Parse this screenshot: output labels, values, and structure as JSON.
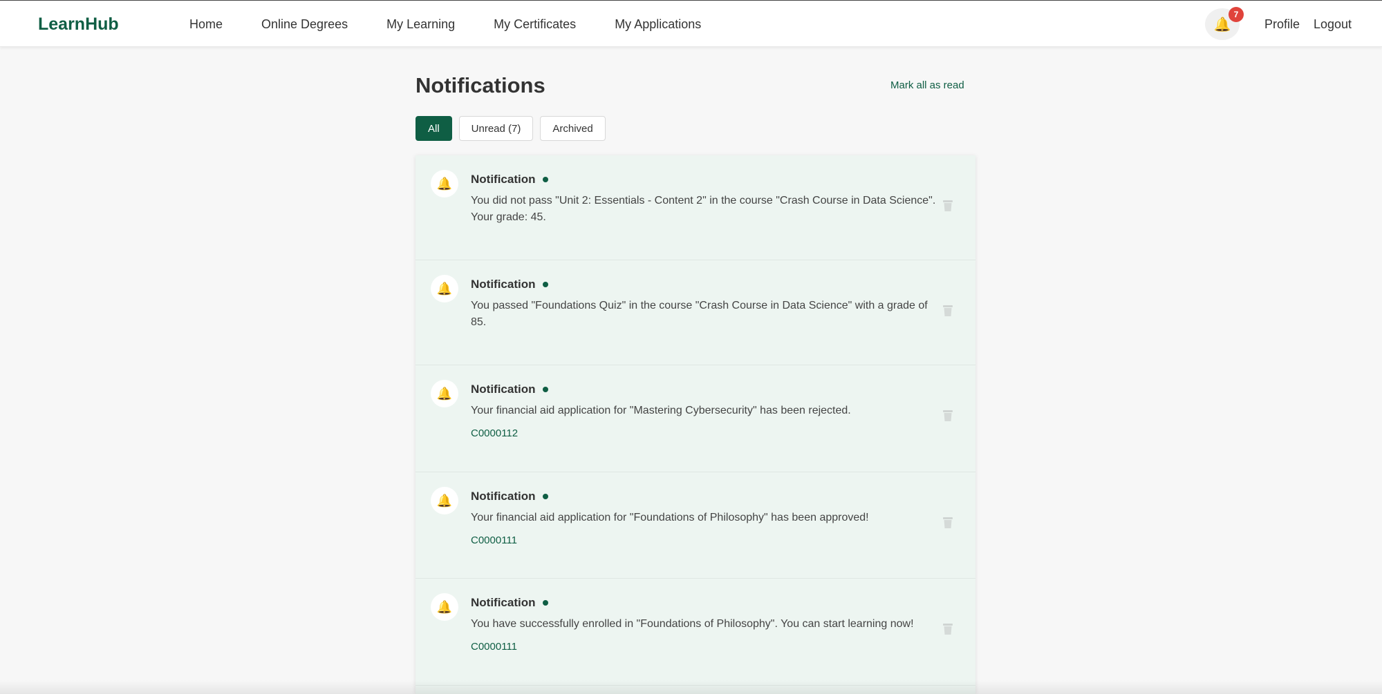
{
  "header": {
    "logo": "LearnHub",
    "nav": [
      "Home",
      "Online Degrees",
      "My Learning",
      "My Certificates",
      "My Applications"
    ],
    "notification_count": "7",
    "profile": "Profile",
    "logout": "Logout"
  },
  "page": {
    "title": "Notifications",
    "mark_all": "Mark all as read",
    "filters": [
      {
        "label": "All",
        "active": true
      },
      {
        "label": "Unread (7)",
        "active": false
      },
      {
        "label": "Archived",
        "active": false
      }
    ]
  },
  "notifications": [
    {
      "title": "Notification",
      "message": "You did not pass \"Unit 2: Essentials - Content 2\" in the course \"Crash Course in Data Science\". Your grade: 45.",
      "code": ""
    },
    {
      "title": "Notification",
      "message": "You passed \"Foundations Quiz\" in the course \"Crash Course in Data Science\" with a grade of 85.",
      "code": ""
    },
    {
      "title": "Notification",
      "message": "Your financial aid application for \"Mastering Cybersecurity\" has been rejected.",
      "code": "C0000112"
    },
    {
      "title": "Notification",
      "message": "Your financial aid application for \"Foundations of Philosophy\" has been approved!",
      "code": "C0000111"
    },
    {
      "title": "Notification",
      "message": "You have successfully enrolled in \"Foundations of Philosophy\". You can start learning now!",
      "code": "C0000111"
    }
  ],
  "colors": {
    "brand": "#0f5e44",
    "badge": "#e0433b",
    "card_bg": "#edf5f1"
  },
  "icons": {
    "bell": "bell-icon",
    "trash": "trash-icon",
    "unread": "unread-dot-icon"
  }
}
